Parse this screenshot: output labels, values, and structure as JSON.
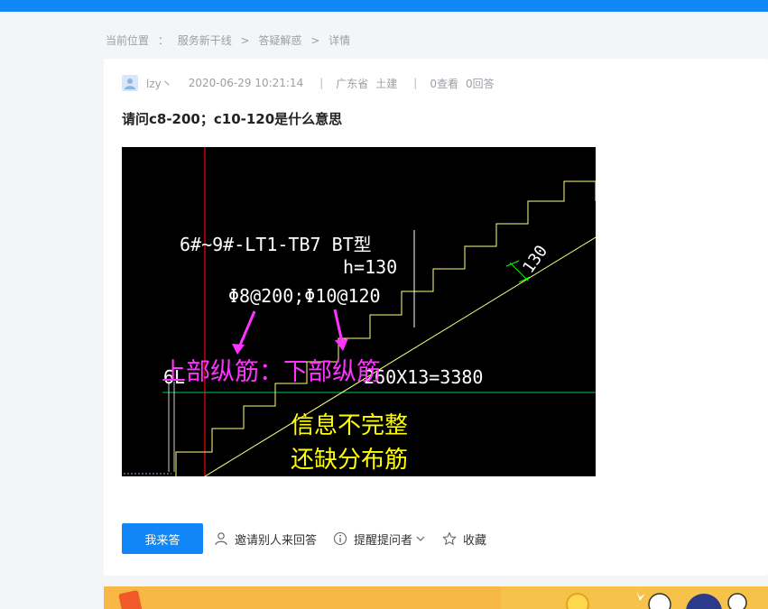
{
  "breadcrumb": {
    "label": "当前位置",
    "colon": "：",
    "items": [
      "服务新干线",
      "答疑解惑",
      "详情"
    ],
    "separator": ">"
  },
  "question": {
    "user": "lzy丶",
    "datetime": "2020-06-29 10:21:14",
    "province": "广东省",
    "category": "土建",
    "views": "0查看",
    "answers": "0回答",
    "title": "请问c8-200；c10-120是什么意思"
  },
  "drawing": {
    "label_line1": "6#~9#-LT1-TB7 BT型",
    "label_h": "h=130",
    "label_rebar": "Φ8@200;Φ10@120",
    "label_dim_left": "6L",
    "label_dim": "260X13=3380",
    "label_130": "130",
    "annotation_magenta": "上部纵筋：下部纵筋",
    "annotation_yellow_1": "信息不完整",
    "annotation_yellow_2": "还缺分布筋",
    "colors": {
      "background": "#000000",
      "magenta": "#ff33ff",
      "yellow": "#ffff00",
      "green": "#00ff00",
      "red": "#ff0000",
      "line": "#ffff80"
    }
  },
  "actions": {
    "answer_button": "我来答",
    "invite": "邀请别人来回答",
    "remind": "提醒提问者",
    "favorite": "收藏"
  },
  "icons": [
    "avatar",
    "user-icon",
    "info-icon",
    "chevron-down-icon",
    "star-icon"
  ],
  "theme": {
    "accent": "#1187f7",
    "background": "#f4f5f7",
    "banner": "#f8b846"
  }
}
